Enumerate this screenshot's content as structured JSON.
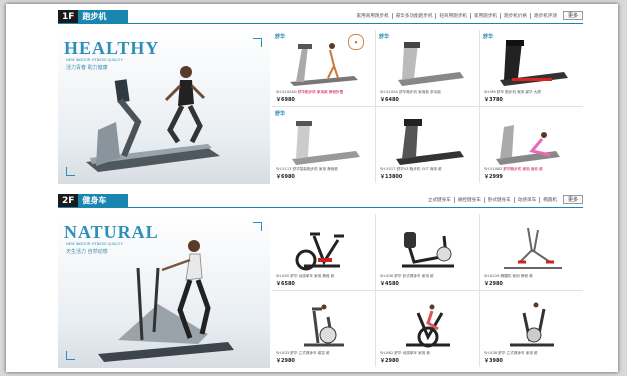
{
  "floors": [
    {
      "num": "1F",
      "name": "跑步机",
      "links": [
        "家用商用跑步机",
        "豪华多功能跑步机",
        "轻商用跑步机",
        "家用跑步机",
        "跑步机价格",
        "跑步机评测"
      ],
      "more": "更多",
      "banner": {
        "title": "HEALTHY",
        "sub1": "NEW INDOOR FITNESS QUALITY",
        "sub2": "活力青春 助力健康"
      },
      "products": [
        {
          "brand": "舒华",
          "desc": "SH-5100AD",
          "desc_hl": "舒华跑步机 家用款 静音折叠",
          "price": "￥6980"
        },
        {
          "brand": "舒华",
          "desc": "SH-5100A 舒华跑步机 家用款 多功能",
          "price": "￥6480"
        },
        {
          "brand": "舒华",
          "desc": "SH-M6 舒华 跑步机 家用 豪华 大屏",
          "price": "￥3780"
        },
        {
          "brand": "舒华",
          "desc": "SH-5113 舒华智能跑步机 家用 静音款",
          "price": "￥6980"
        },
        {
          "brand": "",
          "desc": "SH-5517 舒华V3 跑步机 SUT 商用 款",
          "price": "￥13800"
        },
        {
          "brand": "",
          "desc": "SH-5108D",
          "desc_hl": "舒华跑步机 家用 迷你 款",
          "price": "￥2999"
        }
      ]
    },
    {
      "num": "2F",
      "name": "健身车",
      "links": [
        "立式健身车",
        "磁控健身车",
        "卧式健身车",
        "动感单车",
        "椭圆机"
      ],
      "more": "更多",
      "banner": {
        "title": "NATURAL",
        "sub1": "NEW INDOOR FITNESS QUALITY",
        "sub2": "天生活力 自然动感"
      },
      "products": [
        {
          "brand": "",
          "desc": "SH-850 舒华 动感单车 家用 静音 款",
          "price": "￥6580"
        },
        {
          "brand": "",
          "desc": "SH-836 舒华 卧式健身车 家用 款",
          "price": "￥4580"
        },
        {
          "brand": "",
          "desc": "SH-B226 椭圆机 家用 静音 款",
          "price": "￥2980"
        },
        {
          "brand": "",
          "desc": "SH-833 舒华 立式健身车 磁控 款",
          "price": "￥2980"
        },
        {
          "brand": "",
          "desc": "SH-862 舒华 动感单车 家用 款",
          "price": "￥2980"
        },
        {
          "brand": "",
          "desc": "SH-838 舒华 立式健身车 家用 款",
          "price": "￥3980"
        }
      ]
    }
  ],
  "colors": {
    "accent": "#1a86b0",
    "price": "#222222",
    "highlight": "#cc0033"
  },
  "icons": [
    "treadmill-image",
    "bike-image",
    "elliptical-image"
  ]
}
